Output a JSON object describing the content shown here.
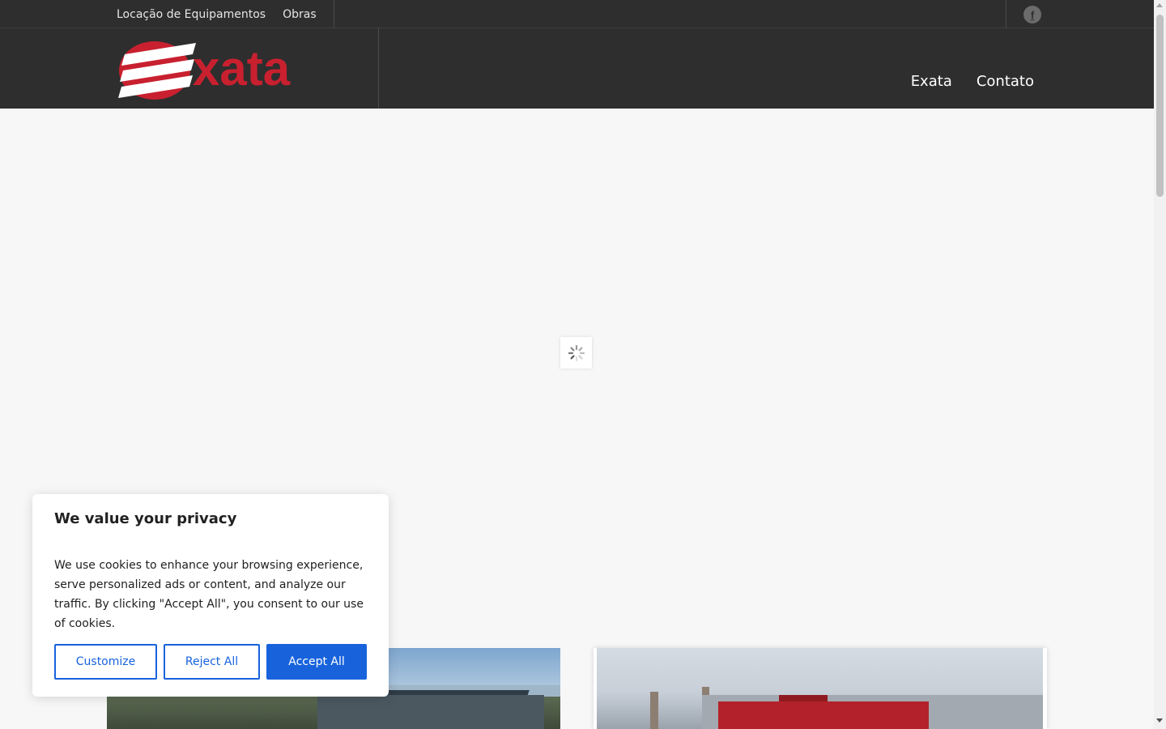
{
  "topbar": {
    "links": [
      "Locação de Equipamentos",
      "Obras"
    ],
    "social_icon": "facebook-icon"
  },
  "header": {
    "logo_text": "xata",
    "nav": [
      "Exata",
      "Contato"
    ]
  },
  "cookie_banner": {
    "title": "We value your privacy",
    "body": "We use cookies to enhance your browsing experience, serve personalized ads or content, and analyze our traffic. By clicking \"Accept All\", you consent to our use of cookies.",
    "customize_label": "Customize",
    "reject_label": "Reject All",
    "accept_label": "Accept All"
  },
  "colors": {
    "header_bg": "#2e2e2e",
    "brand_red": "#c8202f",
    "cookie_accent": "#1863dc"
  }
}
